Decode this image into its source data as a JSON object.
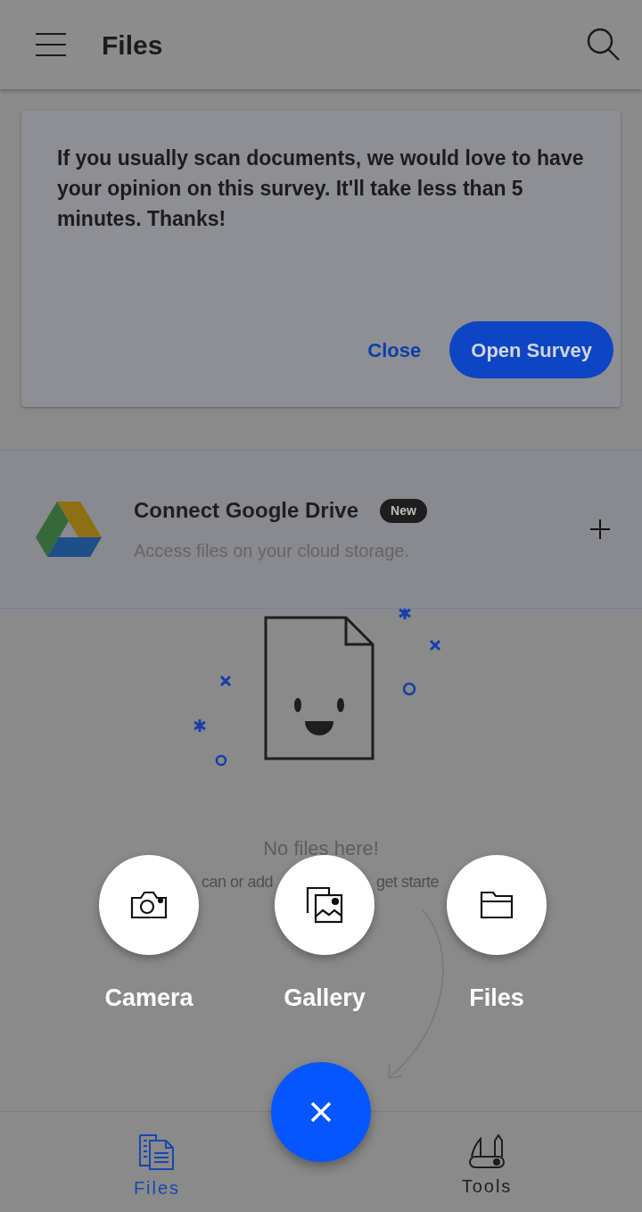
{
  "header": {
    "title": "Files"
  },
  "survey": {
    "message": "If you usually scan documents, we would love to have your opinion on this survey. It'll take less than 5 minutes. Thanks!",
    "buttons": [
      {
        "label": "Close",
        "kind": "text"
      },
      {
        "label": "Open Survey",
        "kind": "primary"
      }
    ]
  },
  "connect": {
    "title": "Connect Google Drive",
    "badge": "New",
    "subtitle": "Access files on your cloud storage."
  },
  "empty_state": {
    "title": "No files here!",
    "fragments": [
      "can or add",
      "get starte"
    ]
  },
  "quick_actions": [
    {
      "label": "Camera",
      "kind": "camera"
    },
    {
      "label": "Gallery",
      "kind": "gallery"
    },
    {
      "label": "Files",
      "kind": "folder"
    }
  ],
  "nav": [
    {
      "label": "Files",
      "kind": "files",
      "selected": true
    },
    {
      "label": "Tools",
      "kind": "tools",
      "selected": false
    }
  ]
}
